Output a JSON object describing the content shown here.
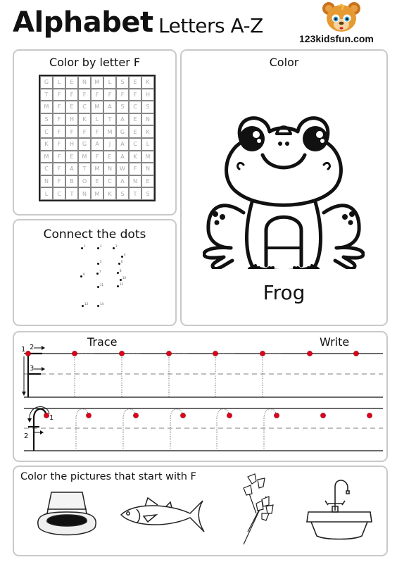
{
  "header": {
    "title_main": "Alphabet",
    "title_sub": "Letters A-Z",
    "logo_text": "123kidsfun.com",
    "logo_icon": "bear-face-icon"
  },
  "color_by_letter": {
    "title": "Color by letter F",
    "target_letter": "F",
    "grid": [
      [
        "G",
        "L",
        "E",
        "N",
        "M",
        "L",
        "S",
        "E",
        "K"
      ],
      [
        "T",
        "F",
        "F",
        "F",
        "F",
        "F",
        "F",
        "F",
        "H"
      ],
      [
        "M",
        "F",
        "E",
        "C",
        "M",
        "A",
        "S",
        "C",
        "S"
      ],
      [
        "S",
        "F",
        "H",
        "K",
        "L",
        "T",
        "A",
        "E",
        "N"
      ],
      [
        "C",
        "F",
        "F",
        "F",
        "F",
        "M",
        "G",
        "E",
        "K"
      ],
      [
        "K",
        "F",
        "H",
        "G",
        "A",
        "J",
        "A",
        "C",
        "L"
      ],
      [
        "M",
        "F",
        "E",
        "M",
        "F",
        "E",
        "A",
        "K",
        "M"
      ],
      [
        "C",
        "F",
        "A",
        "T",
        "M",
        "N",
        "W",
        "F",
        "N"
      ],
      [
        "N",
        "F",
        "B",
        "O",
        "E",
        "C",
        "A",
        "N",
        "E"
      ],
      [
        "L",
        "C",
        "T",
        "N",
        "M",
        "K",
        "S",
        "T",
        "S"
      ]
    ]
  },
  "connect_dots": {
    "title": "Connect the dots",
    "dots": [
      {
        "n": "1"
      },
      {
        "n": "2"
      },
      {
        "n": "3"
      },
      {
        "n": "4"
      },
      {
        "n": "5"
      },
      {
        "n": "6"
      },
      {
        "n": "7"
      },
      {
        "n": "8"
      },
      {
        "n": "9"
      },
      {
        "n": "10"
      },
      {
        "n": "11"
      },
      {
        "n": "12"
      },
      {
        "n": "13"
      },
      {
        "n": "14"
      }
    ]
  },
  "color_panel": {
    "title": "Color",
    "picture": "frog",
    "label": "Frog"
  },
  "trace": {
    "trace_label": "Trace",
    "write_label": "Write",
    "uppercase_stroke_numbers": [
      "1",
      "2",
      "3"
    ],
    "lowercase_stroke_numbers": [
      "1",
      "2"
    ],
    "dot_color": "#e0001a"
  },
  "pictures": {
    "title": "Color the pictures that start with F",
    "items": [
      {
        "name": "hat"
      },
      {
        "name": "fish"
      },
      {
        "name": "flowers"
      },
      {
        "name": "sink-faucet"
      }
    ]
  }
}
